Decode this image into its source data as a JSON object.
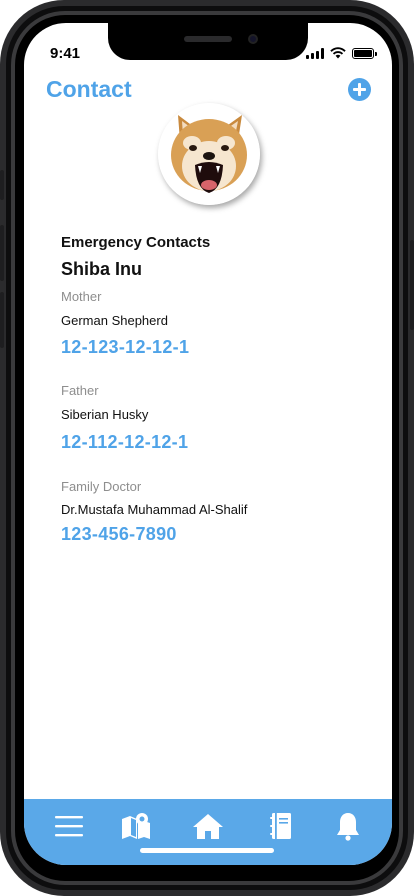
{
  "status_bar": {
    "time": "9:41"
  },
  "header": {
    "title": "Contact"
  },
  "emergency": {
    "section_title": "Emergency Contacts",
    "pet_name": "Shiba Inu",
    "contacts": [
      {
        "relation": "Mother",
        "name": "German Shepherd",
        "phone": "12-123-12-12-1"
      },
      {
        "relation": "Father",
        "name": "Siberian Husky",
        "phone": "12-112-12-12-1"
      },
      {
        "relation": "Family Doctor",
        "name": "Dr.Mustafa Muhammad Al-Shalif",
        "phone": "123-456-7890"
      }
    ]
  },
  "tab_bar": {
    "items": [
      {
        "icon": "menu-icon"
      },
      {
        "icon": "map-icon"
      },
      {
        "icon": "home-icon"
      },
      {
        "icon": "notebook-icon"
      },
      {
        "icon": "bell-icon"
      }
    ]
  },
  "colors": {
    "accent": "#4fa3e8",
    "tab_bar": "#5aa8e8",
    "muted_text": "#8e8e8e"
  }
}
